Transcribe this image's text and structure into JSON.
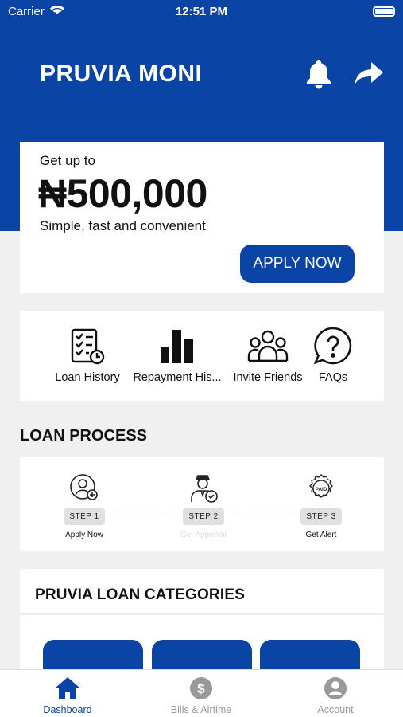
{
  "status_bar": {
    "carrier": "Carrier",
    "time": "12:51 PM"
  },
  "brand": {
    "name": "PRUVIA MONI",
    "primary_color": "#0a44a5"
  },
  "header_icons": [
    "bell-icon",
    "share-icon"
  ],
  "hero": {
    "intro": "Get up to",
    "amount": "₦500,000",
    "tagline": "Simple, fast and convenient",
    "cta": "APPLY NOW"
  },
  "quick_actions": [
    {
      "label": "Loan History",
      "icon": "checklist-clock-icon"
    },
    {
      "label": "Repayment His...",
      "icon": "bar-chart-icon"
    },
    {
      "label": "Invite Friends",
      "icon": "group-icon"
    },
    {
      "label": "FAQs",
      "icon": "question-bubble-icon"
    }
  ],
  "loan_process": {
    "title": "LOAN PROCESS",
    "steps": [
      {
        "step": "STEP 1",
        "caption": "Apply Now",
        "icon": "user-add-icon"
      },
      {
        "step": "STEP 2",
        "caption": "Get Approval",
        "icon": "approved-agent-icon"
      },
      {
        "step": "STEP 3",
        "caption": "Get Alert",
        "icon": "paid-badge-icon"
      }
    ]
  },
  "categories": {
    "title": "PRUVIA LOAN CATEGORIES"
  },
  "tab_bar": [
    {
      "label": "Dashboard",
      "icon": "home-icon",
      "active": true
    },
    {
      "label": "Bills & Airtime",
      "icon": "dollar-coin-icon",
      "active": false
    },
    {
      "label": "Account",
      "icon": "account-icon",
      "active": false
    }
  ]
}
